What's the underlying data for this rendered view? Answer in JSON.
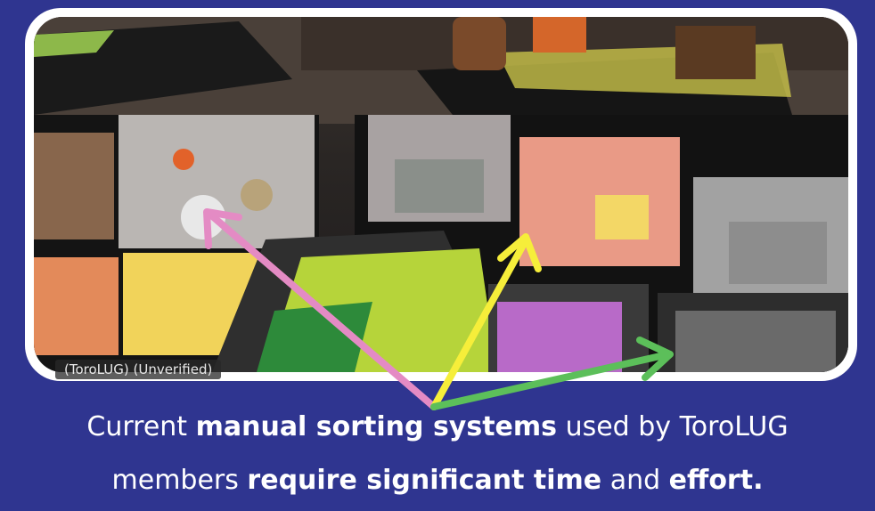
{
  "photo": {
    "overlay_label": "(ToroLUG) (Unverified)"
  },
  "caption": {
    "line1": {
      "pre": "Current ",
      "bold1": "manual sorting systems",
      "post": " used by ToroLUG"
    },
    "line2": {
      "pre": "members ",
      "bold1": "require significant time",
      "mid": " and ",
      "bold2": "effort."
    }
  },
  "colors": {
    "background": "#2f3590",
    "frame": "#ffffff",
    "arrow_pink": "#e48bc4",
    "arrow_yellow": "#f6ee3a",
    "arrow_green": "#5cbf5a"
  }
}
